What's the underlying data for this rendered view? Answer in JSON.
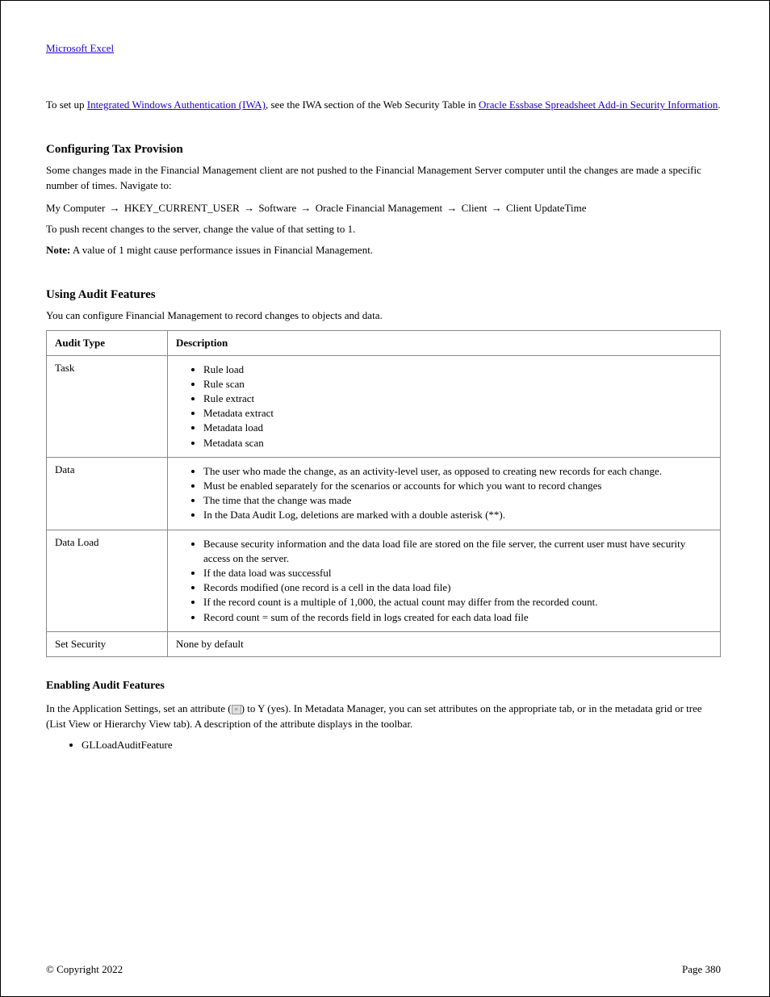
{
  "top": {
    "link1": "Microsoft Excel",
    "para1_before": "To set up ",
    "link2": "Integrated Windows Authentication (IWA)",
    "para1_mid": ", see the IWA section of the Web Security Table in ",
    "link3": "Oracle Essbase Spreadsheet Add-in Security Information",
    "para1_after": ""
  },
  "section1": {
    "heading": "Configuring Tax Provision",
    "p1": "Some changes made in the Financial Management client are not pushed to the Financial Management Server computer until the changes are made a specific number of times. Navigate to:",
    "nav": [
      "My Computer",
      "HKEY_CURRENT_USER",
      "Software",
      "Oracle Financial Management",
      "Client",
      "Client UpdateTime"
    ],
    "p2": "To push recent changes to the server, change the value of that setting to 1.",
    "note_label": "Note:",
    "note_text": " A value of 1 might cause performance issues in Financial Management."
  },
  "section2": {
    "heading": "Using Audit Features",
    "intro": "You can configure Financial Management to record changes to objects and data.",
    "table": {
      "col1": "Audit Type",
      "col2": "Description",
      "rows": [
        {
          "name": "Task",
          "items": [
            "Rule load",
            "Rule scan",
            "Rule extract",
            "Metadata extract",
            "Metadata load",
            "Metadata scan"
          ]
        },
        {
          "name": "Data",
          "items": [
            "The user who made the change, as an activity-level user, as opposed to creating new records for each change.",
            "Must be enabled separately for the scenarios or accounts for which you want to record changes",
            "The time that the change was made",
            "In the Data Audit Log, deletions are marked with a double asterisk (**)."
          ]
        },
        {
          "name": "Data Load",
          "items": [
            "Because security information and the data load file are stored on the file server, the current user must have security access on the server.",
            "If the data load was successful",
            "Records modified (one record is a cell in the data load file)",
            "If the record count is a multiple of 1,000, the actual count may differ from the recorded count.",
            "Record count = sum of the records field in logs created for each data load file"
          ]
        },
        {
          "name": "Set Security",
          "items_text": "None by default"
        }
      ]
    }
  },
  "section3": {
    "heading": "Enabling Audit Features",
    "p1_a": "In the Application Settings, set an attribute (",
    "p1_b": ") to Y (yes). In Metadata Manager, you can set attributes on the appropriate tab, or in the metadata grid or tree (List View or Hierarchy View tab). A description of the attribute displays in the toolbar.",
    "list": [
      "GLLoadAuditFeature"
    ]
  },
  "footer": {
    "left": "© Copyright 2022",
    "right": "Page 380"
  }
}
